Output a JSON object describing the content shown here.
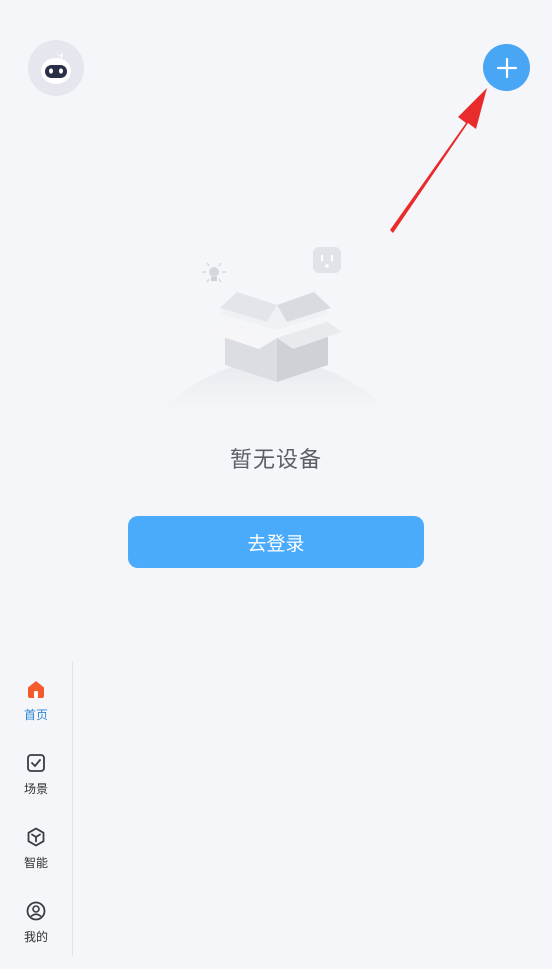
{
  "header": {
    "avatar_icon": "robot-avatar-icon",
    "add_icon": "plus-icon",
    "accent_color": "#48a6f5"
  },
  "main": {
    "empty_text": "暂无设备",
    "login_label": "去登录"
  },
  "nav": {
    "items": [
      {
        "label": "首页",
        "icon": "home-icon",
        "active": true
      },
      {
        "label": "场景",
        "icon": "scene-checkbox-icon",
        "active": false
      },
      {
        "label": "智能",
        "icon": "smart-cube-icon",
        "active": false
      },
      {
        "label": "我的",
        "icon": "profile-icon",
        "active": false
      }
    ]
  }
}
